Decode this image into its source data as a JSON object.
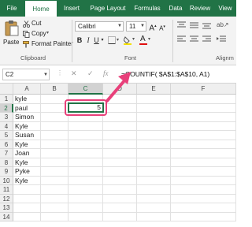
{
  "ribbon": {
    "tabs": [
      "File",
      "Home",
      "Insert",
      "Page Layout",
      "Formulas",
      "Data",
      "Review",
      "View"
    ],
    "active_tab": "Home",
    "clipboard": {
      "paste": "Paste",
      "cut": "Cut",
      "copy": "Copy",
      "format_painter": "Format Painter",
      "group_label": "Clipboard"
    },
    "font": {
      "font_name": "Calibri",
      "font_size": "11",
      "group_label": "Font",
      "bold": "B",
      "italic": "I",
      "underline": "U"
    },
    "alignment": {
      "group_label": "Alignm"
    }
  },
  "formula_bar": {
    "name_box": "C2",
    "cancel_symbol": "✕",
    "enter_symbol": "✓",
    "fx_symbol": "fx",
    "formula": "=COUNTIF( $A$1:$A$10, A1)"
  },
  "sheet": {
    "columns": [
      "A",
      "B",
      "C",
      "D",
      "E",
      "F"
    ],
    "rows": [
      "1",
      "2",
      "3",
      "4",
      "5",
      "6",
      "7",
      "8",
      "9",
      "10",
      "11",
      "12",
      "13",
      "14"
    ],
    "column_a": [
      "kyle",
      "paul",
      "Simon",
      "Kyle",
      "Susan",
      "Kyle",
      "Joan",
      "Kyle",
      "Pyke",
      "Kyle"
    ],
    "c2_value": "5"
  },
  "colors": {
    "excel_green": "#217346",
    "annotation_pink": "#e8407a"
  }
}
